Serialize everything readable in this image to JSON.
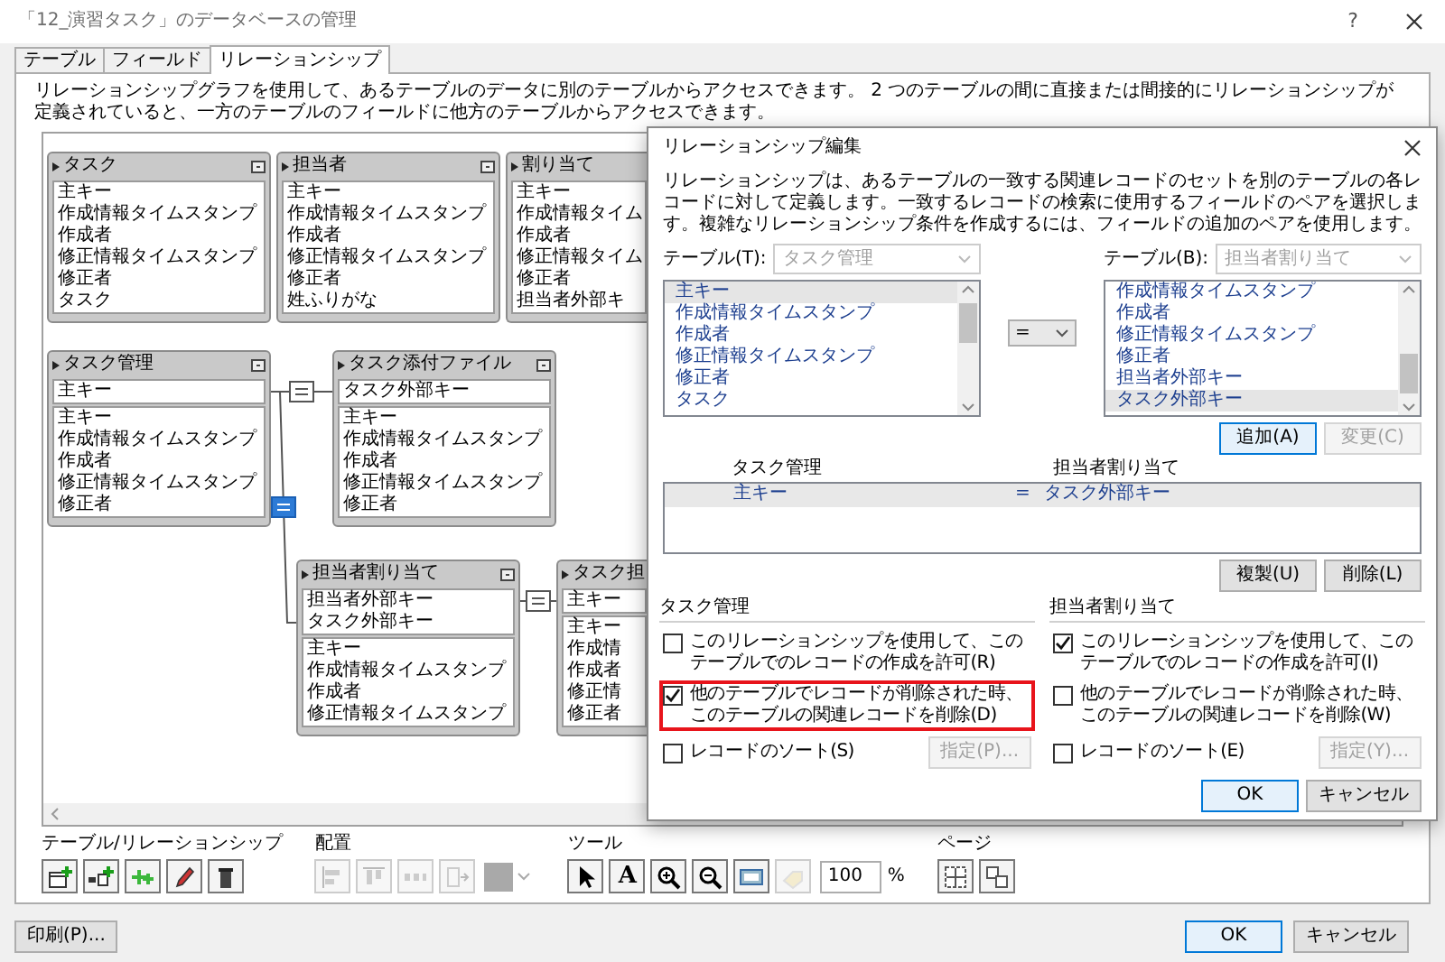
{
  "window": {
    "title": "「12_演習タスク」のデータベースの管理",
    "help": "?"
  },
  "tabs": [
    {
      "label": "テーブル",
      "selected": false
    },
    {
      "label": "フィールド",
      "selected": false
    },
    {
      "label": "リレーションシップ",
      "selected": true
    }
  ],
  "description": "リレーションシップグラフを使用して、あるテーブルのデータに別のテーブルからアクセスできます。 2 つのテーブルの間に直接または間接的にリレーションシップが定義されていると、一方のテーブルのフィールドに他方のテーブルからアクセスできます。",
  "graph": {
    "tables": [
      {
        "name": "タスク",
        "fields": [
          "主キー",
          "作成情報タイムスタンプ",
          "作成者",
          "修正情報タイムスタンプ",
          "修正者",
          "タスク"
        ]
      },
      {
        "name": "担当者",
        "fields": [
          "主キー",
          "作成情報タイムスタンプ",
          "作成者",
          "修正情報タイムスタンプ",
          "修正者",
          "姓ふりがな"
        ]
      },
      {
        "name": "割り当て",
        "fields": [
          "主キー",
          "作成情報タイム",
          "作成者",
          "修正情報タイム",
          "修正者",
          "担当者外部キ"
        ]
      },
      {
        "name": "タスク管理",
        "keys": [
          "主キー"
        ],
        "fields": [
          "主キー",
          "作成情報タイムスタンプ",
          "作成者",
          "修正情報タイムスタンプ",
          "修正者"
        ]
      },
      {
        "name": "タスク添付ファイル",
        "keys": [
          "タスク外部キー"
        ],
        "fields": [
          "主キー",
          "作成情報タイムスタンプ",
          "作成者",
          "修正情報タイムスタンプ",
          "修正者"
        ]
      },
      {
        "name": "担当者割り当て",
        "keys": [
          "担当者外部キー",
          "タスク外部キー"
        ],
        "fields": [
          "主キー",
          "作成情報タイムスタンプ",
          "作成者",
          "修正情報タイムスタンプ"
        ]
      },
      {
        "name": "タスク担",
        "keys": [
          "主キー"
        ],
        "fields": [
          "主キー",
          "作成情",
          "作成者",
          "修正情",
          "修正者"
        ]
      }
    ],
    "relationships": [
      {
        "selected": false
      },
      {
        "selected": true
      },
      {
        "selected": false
      }
    ]
  },
  "toolbar": {
    "groups": [
      {
        "label": "テーブル/リレーションシップ",
        "tools": [
          {
            "kind": "new-table",
            "disabled": false
          },
          {
            "kind": "new-relation",
            "disabled": false
          },
          {
            "kind": "duplicate",
            "disabled": false
          },
          {
            "kind": "edit",
            "disabled": false
          },
          {
            "kind": "delete",
            "disabled": false
          }
        ]
      },
      {
        "label": "配置",
        "tools": [
          {
            "kind": "align-left",
            "disabled": true
          },
          {
            "kind": "align-top",
            "disabled": true
          },
          {
            "kind": "distribute",
            "disabled": true
          },
          {
            "kind": "resize",
            "disabled": true
          },
          {
            "kind": "color",
            "disabled": true
          }
        ]
      },
      {
        "label": "ツール",
        "tools": [
          {
            "kind": "pointer",
            "disabled": false
          },
          {
            "kind": "text",
            "label": "A",
            "disabled": false
          },
          {
            "kind": "zoom-in",
            "disabled": false
          },
          {
            "kind": "zoom-out",
            "disabled": false
          },
          {
            "kind": "fit",
            "disabled": false
          },
          {
            "kind": "hide",
            "disabled": true
          }
        ],
        "zoom": {
          "value": "100",
          "unit": "%"
        }
      },
      {
        "label": "ページ",
        "tools": [
          {
            "kind": "page-breaks",
            "disabled": false
          },
          {
            "kind": "page-setup",
            "disabled": false
          }
        ]
      }
    ]
  },
  "buttons": {
    "print": "印刷(P)...",
    "ok": "OK",
    "cancel": "キャンセル"
  },
  "dialog": {
    "title": "リレーションシップ編集",
    "description": "リレーションシップは、あるテーブルの一致する関連レコードのセットを別のテーブルの各レコードに対して定義します。一致するレコードの検索に使用するフィールドのペアを選択します。複雑なリレーションシップ条件を作成するには、フィールドの追加のペアを使用します。",
    "left": {
      "label": "テーブル(T):",
      "table": "タスク管理",
      "disabled": true,
      "fields": [
        {
          "name": "主キー",
          "selected": true
        },
        {
          "name": "作成情報タイムスタンプ",
          "selected": false
        },
        {
          "name": "作成者",
          "selected": false
        },
        {
          "name": "修正情報タイムスタンプ",
          "selected": false
        },
        {
          "name": "修正者",
          "selected": false
        },
        {
          "name": "タスク",
          "selected": false
        }
      ]
    },
    "operator": "=",
    "right": {
      "label": "テーブル(B):",
      "table": "担当者割り当て",
      "disabled": true,
      "fields": [
        {
          "name": "作成情報タイムスタンプ",
          "selected": false
        },
        {
          "name": "作成者",
          "selected": false
        },
        {
          "name": "修正情報タイムスタンプ",
          "selected": false
        },
        {
          "name": "修正者",
          "selected": false
        },
        {
          "name": "担当者外部キー",
          "selected": false
        },
        {
          "name": "タスク外部キー",
          "selected": true
        }
      ]
    },
    "add_button": {
      "label": "追加(A)",
      "disabled": false
    },
    "change_button": {
      "label": "変更(C)",
      "disabled": true
    },
    "pairs": {
      "columns": [
        "タスク管理",
        "担当者割り当て"
      ],
      "rows": [
        {
          "left": "主キー",
          "operator": "=",
          "right": "タスク外部キー",
          "selected": true
        }
      ]
    },
    "duplicate_button": {
      "label": "複製(U)",
      "disabled": false
    },
    "delete_button": {
      "label": "削除(L)",
      "disabled": false
    },
    "options": [
      {
        "title": "タスク管理",
        "checks": [
          {
            "label": "このリレーションシップを使用して、このテーブルでのレコードの作成を許可(R)",
            "checked": false,
            "highlighted": false
          },
          {
            "label": "他のテーブルでレコードが削除された時、このテーブルの関連レコードを削除(D)",
            "checked": true,
            "highlighted": true
          },
          {
            "label": "レコードのソート(S)",
            "checked": false,
            "highlighted": false
          }
        ],
        "sort_button": {
          "label": "指定(P)...",
          "disabled": true
        }
      },
      {
        "title": "担当者割り当て",
        "checks": [
          {
            "label": "このリレーションシップを使用して、このテーブルでのレコードの作成を許可(I)",
            "checked": true,
            "highlighted": false
          },
          {
            "label": "他のテーブルでレコードが削除された時、このテーブルの関連レコードを削除(W)",
            "checked": false,
            "highlighted": false
          },
          {
            "label": "レコードのソート(E)",
            "checked": false,
            "highlighted": false
          }
        ],
        "sort_button": {
          "label": "指定(Y)...",
          "disabled": true
        }
      }
    ],
    "ok": "OK",
    "cancel": "キャンセル"
  }
}
